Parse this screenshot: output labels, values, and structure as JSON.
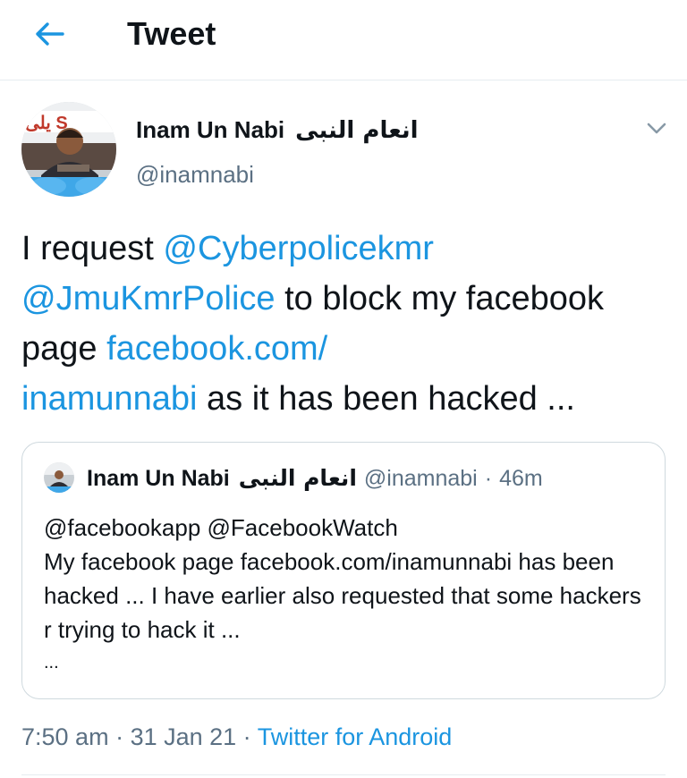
{
  "header": {
    "title": "Tweet",
    "back_icon": "arrow-left-icon",
    "accent_color": "#1b95e0"
  },
  "tweet": {
    "author": {
      "name": "Inam Un Nabi",
      "name_urdu": "انعام النبی",
      "handle": "@inamnabi",
      "avatar_banner_text": "يلى S"
    },
    "body": {
      "part1": "I request ",
      "mention1": "@Cyberpolicekmr",
      "mention2": "@JmuKmrPolice",
      "part2": " to block my facebook page ",
      "link1": "facebook.com/",
      "link2": "inamunnabi",
      "part3": " as it has been hacked ..."
    },
    "quoted": {
      "name": "Inam Un Nabi",
      "name_urdu": "انعام النبی",
      "handle": "@inamnabi",
      "separator": "·",
      "time": "46m",
      "line1": "@facebookapp @FacebookWatch",
      "line2": "My facebook page facebook.com/inamunnabi has been hacked ... I have earlier also requested that some hackers r trying to hack it ...",
      "more": "..."
    },
    "meta": {
      "time": "7:50 am",
      "sep1": " · ",
      "date": "31 Jan 21",
      "sep2": " · ",
      "source": "Twitter for Android"
    }
  }
}
